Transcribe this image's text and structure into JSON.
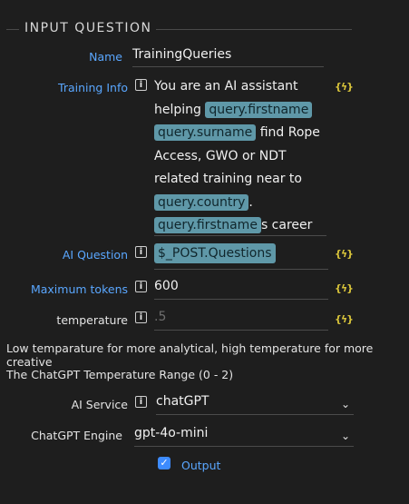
{
  "section": {
    "title": "INPUT QUESTION"
  },
  "name_field": {
    "label": "Name",
    "value": "TrainingQueries"
  },
  "training_info": {
    "label": "Training Info",
    "text_1": "You are an AI assistant helping ",
    "tag_1": "query.firstname",
    "tag_2": "query.surname",
    "text_2": " find Rope Access, GWO or NDT related training near to ",
    "tag_3": "query.country",
    "text_3": ". ",
    "tag_4": "query.firstname",
    "text_4": "s career comments are:"
  },
  "ai_question": {
    "label": "AI Question",
    "value": "$_POST.Questions"
  },
  "max_tokens": {
    "label": "Maximum tokens",
    "value": "600"
  },
  "temperature": {
    "label": "temperature",
    "placeholder": ".5"
  },
  "notes": {
    "line1": "Low temparature for more analytical, high temperature for more creative",
    "line2": "The ChatGPT Temperature Range (0 - 2)"
  },
  "ai_service": {
    "label": "AI Service",
    "value": "chatGPT"
  },
  "engine": {
    "label": "ChatGPT Engine",
    "value": "gpt-4o-mini"
  },
  "output": {
    "label": "Output",
    "checked": true
  },
  "icons": {
    "info": "info-icon",
    "bolt": "lightning-bolt-icon",
    "caret": "chevron-down-icon",
    "check": "check-icon"
  },
  "colors": {
    "background": "#1e1e1e",
    "label_blue": "#5aa7ff",
    "tag_bg": "#5f98a8",
    "bolt": "#d7c33a",
    "checkbox": "#3d8bff"
  }
}
